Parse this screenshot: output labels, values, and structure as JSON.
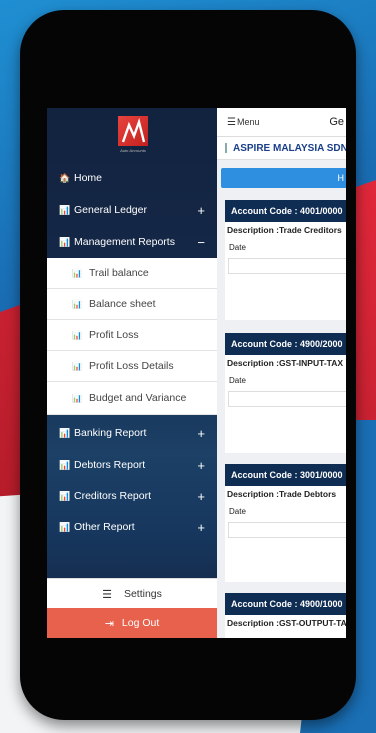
{
  "sidebar": {
    "logo_tagline": "Auto Accounts",
    "items": [
      {
        "label": "Home",
        "icon": "home-icon",
        "glyph": "🏠"
      },
      {
        "label": "General Ledger",
        "icon": "bar-chart-icon",
        "glyph": "📊",
        "toggle": "+"
      },
      {
        "label": "Management Reports",
        "icon": "bar-chart-icon",
        "glyph": "📊",
        "toggle": "−"
      },
      {
        "label": "Banking Report",
        "icon": "bar-chart-icon",
        "glyph": "📊",
        "toggle": "+"
      },
      {
        "label": "Debtors Report",
        "icon": "bar-chart-icon",
        "glyph": "📊",
        "toggle": "+"
      },
      {
        "label": "Creditors Report",
        "icon": "bar-chart-icon",
        "glyph": "📊",
        "toggle": "+"
      },
      {
        "label": "Other Report",
        "icon": "bar-chart-icon",
        "glyph": "📊",
        "toggle": "+"
      }
    ],
    "sub_items": [
      {
        "label": "Trail balance"
      },
      {
        "label": "Balance sheet"
      },
      {
        "label": "Profit Loss"
      },
      {
        "label": "Profit Loss Details"
      },
      {
        "label": "Budget and Variance"
      }
    ],
    "settings_label": "Settings",
    "logout_label": "Log Out"
  },
  "topbar": {
    "menu_label": "Menu",
    "title_partial": "Ge"
  },
  "company": {
    "name": "ASPIRE MALAYSIA SDN"
  },
  "home_bar_label": "H",
  "cards": [
    {
      "account": "Account Code : 4001/0000",
      "description": "Description :Trade Creditors",
      "date_label": "Date"
    },
    {
      "account": "Account Code : 4900/2000",
      "description": "Description :GST-INPUT-TAX",
      "date_label": "Date"
    },
    {
      "account": "Account Code : 3001/0000",
      "description": "Description :Trade Debtors",
      "date_label": "Date"
    },
    {
      "account": "Account Code : 4900/1000",
      "description": "Description :GST-OUTPUT-TAX",
      "date_label": ""
    }
  ],
  "colors": {
    "sidebar_bg": "#12233f",
    "logout_bg": "#e8614d",
    "card_header": "#0f2c52",
    "accent_blue": "#2e8fe0",
    "company_text": "#1a3f8a"
  }
}
